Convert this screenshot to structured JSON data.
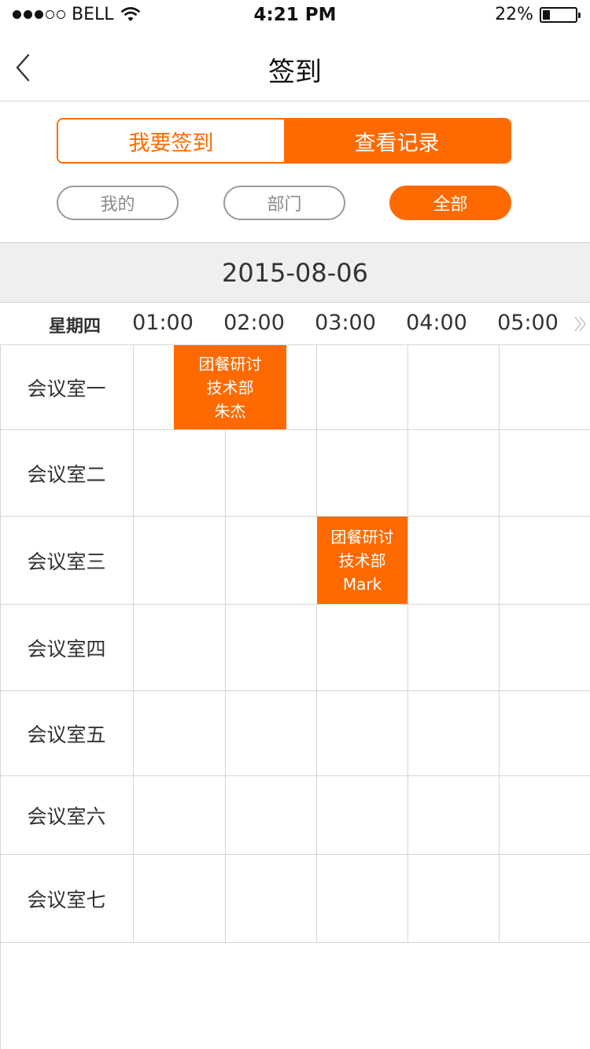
{
  "status_bar": {
    "carrier": "BELL",
    "time": "4:21 PM",
    "battery": "22%",
    "battery_level": 0.22,
    "icons": [
      "signal-dots",
      "wifi-icon",
      "battery-icon"
    ]
  },
  "nav": {
    "title": "签到",
    "back_icon": "chevron-left-icon"
  },
  "segment": {
    "options": [
      "我要签到",
      "查看记录"
    ],
    "selected": 1
  },
  "filters": {
    "options": [
      "我的",
      "部门",
      "全部"
    ],
    "selected": 2
  },
  "date": "2015-08-06",
  "schedule": {
    "weekday": "星期四",
    "hours": [
      "01:00",
      "02:00",
      "03:00",
      "04:00",
      "05:00"
    ],
    "more_icon": "double-chevron-right-icon",
    "rooms": [
      "会议室一",
      "会议室二",
      "会议室三",
      "会议室四",
      "会议室五",
      "会议室六",
      "会议室七"
    ],
    "events": [
      {
        "room": "会议室一",
        "title": "团餐研讨",
        "department": "技术部",
        "person": "朱杰"
      },
      {
        "room": "会议室三",
        "title": "团餐研讨",
        "department": "技术部",
        "person": "Mark"
      }
    ]
  },
  "colors": {
    "accent": "#ff6a00",
    "grid_line": "#d6d6d6",
    "date_bar_bg": "#efefef"
  }
}
